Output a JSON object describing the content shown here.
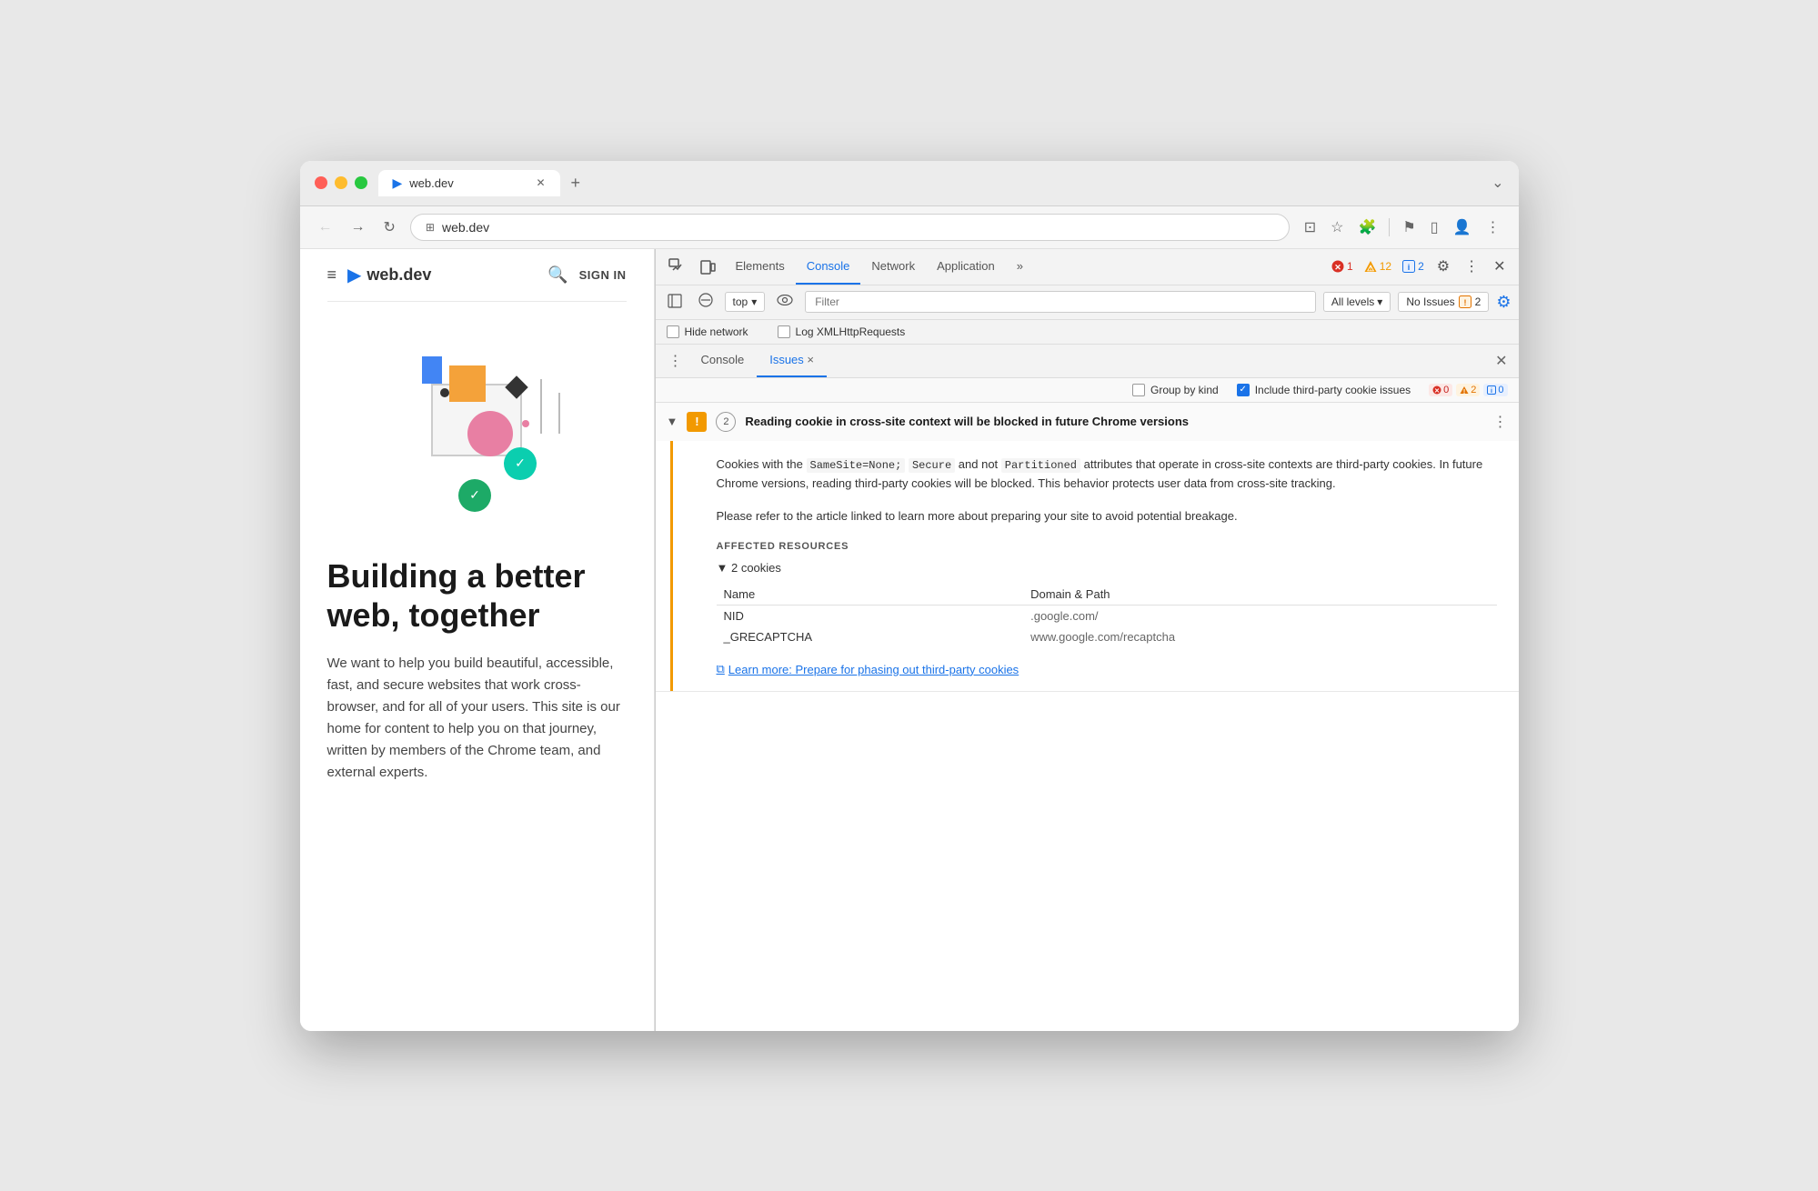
{
  "browser": {
    "tab_title": "web.dev",
    "tab_icon": "▶",
    "address": "web.dev",
    "new_tab_label": "+",
    "window_chevron": "⌄"
  },
  "nav": {
    "back_label": "←",
    "forward_label": "→",
    "reload_label": "↻",
    "address_icon": "⊞",
    "address_text": "web.dev"
  },
  "nav_actions": {
    "cast": "⊡",
    "bookmark": "☆",
    "extensions": "🧩",
    "performance": "⚑",
    "sidebar": "▯",
    "profile": "👤",
    "menu": "⋮"
  },
  "webpage": {
    "hamburger": "≡",
    "logo_icon": "▶",
    "logo_text": "web.dev",
    "search_label": "🔍",
    "sign_in": "SIGN IN",
    "hero_alt": "Building illustration",
    "page_title": "Building a better web, together",
    "page_body": "We want to help you build beautiful, accessible, fast, and secure websites that work cross-browser, and for all of your users. This site is our home for content to help you on that journey, written by members of the Chrome team, and external experts."
  },
  "devtools": {
    "toolbar": {
      "inspect_icon": "⊡",
      "device_icon": "▭",
      "tabs": [
        {
          "label": "Elements",
          "active": false
        },
        {
          "label": "Console",
          "active": true
        },
        {
          "label": "Network",
          "active": false
        },
        {
          "label": "Application",
          "active": false
        },
        {
          "label": "»",
          "active": false
        }
      ],
      "badges": {
        "error_icon": "✕",
        "error_count": "1",
        "warn_icon": "⚠",
        "warn_count": "12",
        "info_icon": "ℹ",
        "info_count": "2"
      },
      "settings_icon": "⚙",
      "more_icon": "⋮",
      "close_icon": "✕"
    },
    "console_bar": {
      "sidebar_icon": "▯",
      "clear_icon": "⊘",
      "context_label": "top",
      "context_arrow": "▾",
      "eye_icon": "👁",
      "filter_placeholder": "Filter",
      "levels_label": "All levels",
      "levels_arrow": "▾",
      "issues_label": "No Issues",
      "issues_badge": "2",
      "settings_icon": "⚙"
    },
    "checkbox_bar": {
      "hide_network": "Hide network",
      "log_xml": "Log XMLHttpRequests"
    },
    "issues_tabbar": {
      "console_tab": "Console",
      "issues_tab": "Issues",
      "issues_x": "×",
      "close_icon": "✕"
    },
    "issues_options": {
      "group_by_kind": "Group by kind",
      "include_third_party": "Include third-party cookie issues",
      "badge_error_count": "0",
      "badge_warn_count": "2",
      "badge_info_count": "0"
    },
    "issue": {
      "arrow": "▼",
      "count": "2",
      "title": "Reading cookie in cross-site context will be blocked in future Chrome versions",
      "more_icon": "⋮",
      "description_1": "Cookies with the ",
      "code1": "SameSite=None;",
      "description_2": " ",
      "code2": "Secure",
      "description_3": " and not ",
      "code3": "Partitioned",
      "description_4": " attributes that operate in cross-site contexts are third-party cookies. In future Chrome versions, reading third-party cookies will be blocked. This behavior protects user data from cross-site tracking.",
      "description_p2": "Please refer to the article linked to learn more about preparing your site to avoid potential breakage.",
      "affected_resources": "AFFECTED RESOURCES",
      "cookies_toggle": "▼ 2 cookies",
      "col_name": "Name",
      "col_domain": "Domain & Path",
      "cookie1_name": "NID",
      "cookie1_domain": ".google.com/",
      "cookie2_name": "_GRECAPTCHA",
      "cookie2_domain": "www.google.com/recaptcha",
      "learn_more_icon": "⧉",
      "learn_more_text": "Learn more: Prepare for phasing out third-party cookies"
    }
  }
}
